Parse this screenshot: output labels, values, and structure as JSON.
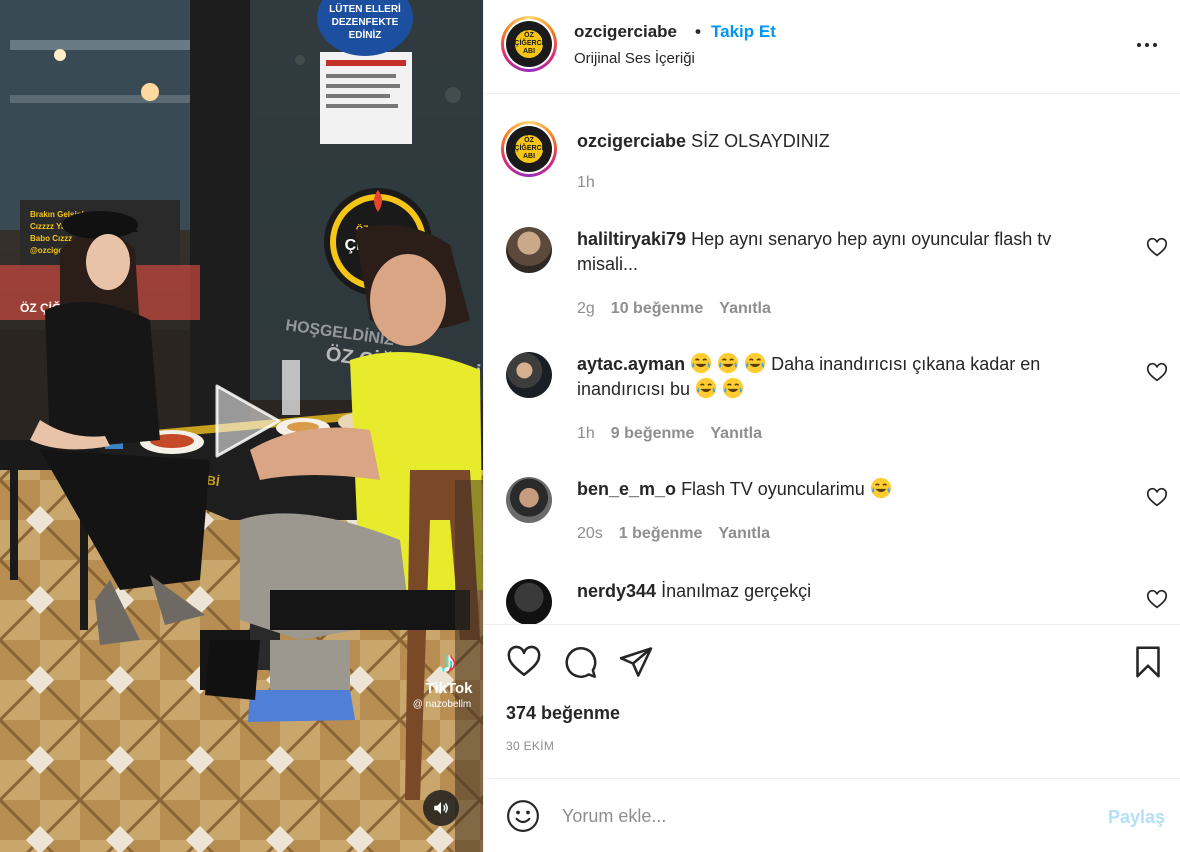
{
  "video": {
    "tiktok_brand": "TikTok",
    "tiktok_handle": "@ nazobellm",
    "tiktok_glyph": "♪",
    "play_icon": "play-icon",
    "mute_icon": "speaker-icon",
    "signs": {
      "dezenfekte": "LÜTEN ELLERİ DEZENFEKTE EDİNİZ",
      "brand_top": "ÖZ",
      "brand_mid": "ÇİĞERCİ",
      "brand_bot": "ABI",
      "hosgeldiniz": "HOŞGELDİNİZ",
      "oz_cigerci_abi": "ÖZ ÇİĞERCİ ABİ",
      "board_text": "Brakın Gelsinler Cızzzz Yap Babo Cızzz @ozciger",
      "oz_cigerci_small": "ÖZ ÇİĞERCİ",
      "table_brand": "ÇİĞERCİ ABİ"
    }
  },
  "header": {
    "username": "ozcigerciabe",
    "separator": "•",
    "follow_label": "Takip Et",
    "subtitle": "Orijinal Ses İçeriği",
    "avatar_text": "ÖZ ÇİĞERCİ ABI"
  },
  "caption": {
    "username": "ozcigerciabe",
    "text": "SİZ OLSAYDINIZ",
    "time": "1h"
  },
  "comments": [
    {
      "username": "haliltiryaki79",
      "text_before": "Hep aynı senaryo hep aynı oyuncular flash tv misali...",
      "text_after": "",
      "time": "2g",
      "likes": "10 beğenme",
      "reply": "Yanıtla"
    },
    {
      "username": "aytac.ayman",
      "text_before": "Daha inandırıcısı çıkana kadar en inandırıcısı bu",
      "text_after": "",
      "time": "1h",
      "likes": "9 beğenme",
      "reply": "Yanıtla"
    },
    {
      "username": "ben_e_m_o",
      "text_before": "Flash TV oyuncularimu",
      "text_after": "",
      "time": "20s",
      "likes": "1 beğenme",
      "reply": "Yanıtla"
    },
    {
      "username": "nerdy344",
      "text_before": "İnanılmaz gerçekçi",
      "text_after": "",
      "time": "",
      "likes": "",
      "reply": ""
    }
  ],
  "actions": {
    "like_icon": "heart-icon",
    "comment_icon": "comment-icon",
    "share_icon": "send-icon",
    "save_icon": "bookmark-icon"
  },
  "stats": {
    "likes": "374 beğenme",
    "date": "30 EKİM"
  },
  "comment_box": {
    "placeholder": "Yorum ekle...",
    "post_label": "Paylaş"
  },
  "colors": {
    "link_blue": "#0095f6",
    "post_disabled": "#b2dffc",
    "muted": "#8e8e8e",
    "text": "#262626",
    "shirt_yellow": "#e8ea2c",
    "brand_yellow": "#f5c518"
  }
}
